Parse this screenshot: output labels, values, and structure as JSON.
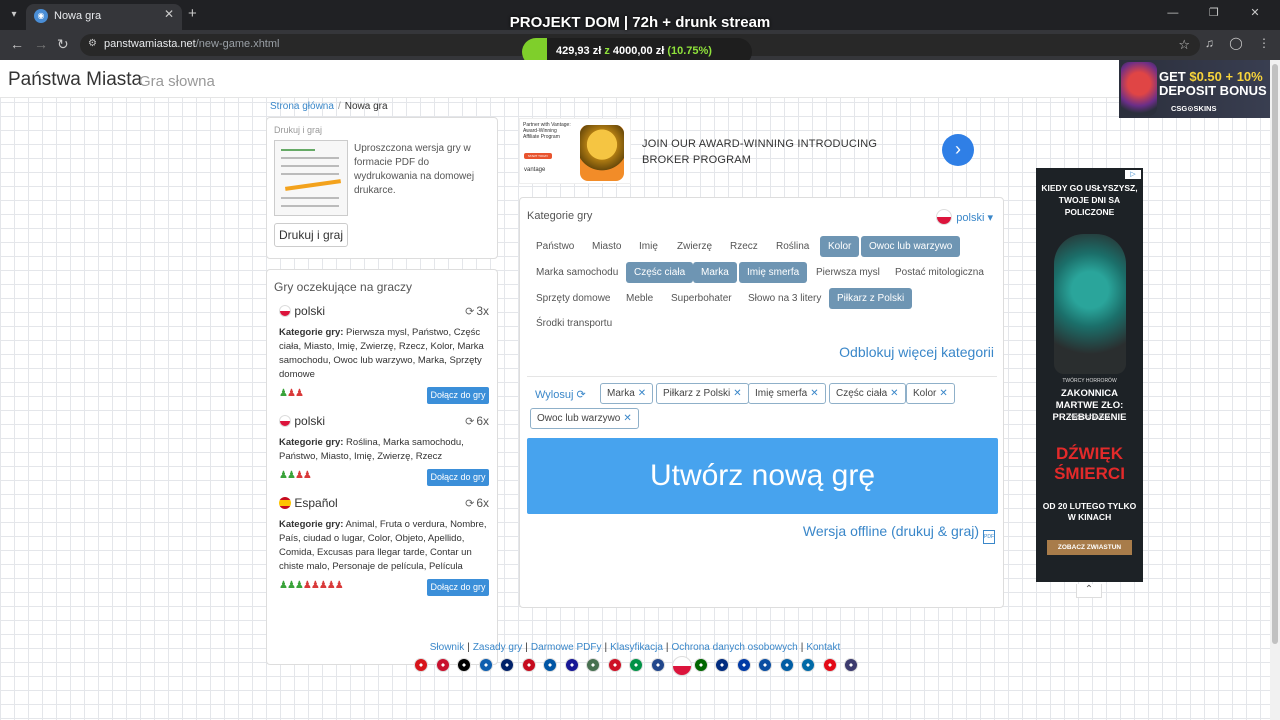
{
  "browser": {
    "tab_title": "Nowa gra",
    "url_host": "panstwamiasta.net",
    "url_path": "/new-game.xhtml"
  },
  "overlay": {
    "title": "PROJEKT DOM | 72h + drunk stream",
    "goal_current": "429,93 zł",
    "goal_sep": "z",
    "goal_target": "4000,00 zł",
    "goal_percent": "(10.75%)",
    "goal_fraction": 0.1075
  },
  "header": {
    "title": "Państwa Miasta",
    "subtitle": "Gra słowna"
  },
  "breadcrumb": {
    "home": "Strona główna",
    "sep": "/",
    "current": "Nowa gra"
  },
  "print_card": {
    "heading": "Drukuj i graj",
    "description": "Uproszczona wersja gry w formacie PDF do wydrukowania na domowej drukarce.",
    "button": "Drukuj i graj"
  },
  "games": {
    "title": "Gry oczekujące na graczy",
    "join_label": "Dołącz do gry",
    "cats_label": "Kategorie gry:",
    "items": [
      {
        "lang": "polski",
        "count": "3x",
        "categories": "Pierwsza mysl, Państwo, Częśc ciała, Miasto, Imię, Zwierzę, Rzecz, Kolor, Marka samochodu, Owoc lub warzywo, Marka, Sprzęty domowe",
        "players_green": 1,
        "players_red": 2
      },
      {
        "lang": "polski",
        "count": "6x",
        "categories": "Roślina, Marka samochodu, Państwo, Miasto, Imię, Zwierzę, Rzecz",
        "players_green": 2,
        "players_red": 2
      },
      {
        "lang": "Español",
        "count": "6x",
        "categories": "Animal, Fruta o verdura, Nombre, País, ciudad o lugar, Color, Objeto, Apellido, Comida, Excusas para llegar tarde, Contar un chiste malo, Personaje de película, Película",
        "players_green": 3,
        "players_red": 5
      }
    ]
  },
  "ad_top": {
    "img_text": "Partner with Vantage: Award-Winning Affiliate Program",
    "img_button": "START TODAY",
    "img_brand": "vantage",
    "text": "JOIN OUR AWARD-WINNING INTRODUCING BROKER PROGRAM",
    "next_icon": "chevron-right"
  },
  "categories": {
    "title": "Kategorie gry",
    "language": "polski",
    "chips": [
      {
        "label": "Państwo",
        "selected": false
      },
      {
        "label": "Miasto",
        "selected": false
      },
      {
        "label": "Imię",
        "selected": false
      },
      {
        "label": "Zwierzę",
        "selected": false
      },
      {
        "label": "Rzecz",
        "selected": false
      },
      {
        "label": "Roślina",
        "selected": false
      },
      {
        "label": "Kolor",
        "selected": true
      },
      {
        "label": "Owoc lub warzywo",
        "selected": true
      },
      {
        "label": "Marka samochodu",
        "selected": false
      },
      {
        "label": "Częśc ciała",
        "selected": true
      },
      {
        "label": "Marka",
        "selected": true
      },
      {
        "label": "Imię smerfa",
        "selected": true
      },
      {
        "label": "Pierwsza mysl",
        "selected": false
      },
      {
        "label": "Postać mitologiczna",
        "selected": false
      },
      {
        "label": "Sprzęty domowe",
        "selected": false
      },
      {
        "label": "Meble",
        "selected": false
      },
      {
        "label": "Superbohater",
        "selected": false
      },
      {
        "label": "Słowo na 3 litery",
        "selected": false
      },
      {
        "label": "Piłkarz z Polski",
        "selected": true
      },
      {
        "label": "Środki transportu",
        "selected": false
      }
    ],
    "unlock": "Odblokuj więcej kategorii",
    "draw": "Wylosuj",
    "selected_tags": [
      "Marka",
      "Piłkarz z Polski",
      "Imię smerfa",
      "Częśc ciała",
      "Kolor",
      "Owoc lub warzywo"
    ],
    "create_button": "Utwórz nową grę",
    "offline": "Wersja offline (drukuj & graj)",
    "offline_icon": "PDF"
  },
  "ad_side": {
    "choices": "▷",
    "line1": "KIEDY GO USŁYSZYSZ, TWOJE DNI SA POLICZONE",
    "small": "TWÓRCY HORRORÓW",
    "line2": "ZAKONNICA MARTWE ZŁO: PRZEBUDZENIE",
    "presents": "PRZEDSTAWIAJĄ",
    "title": "DŹWIĘK ŚMIERCI",
    "date": "OD 20 LUTEGO TYLKO W KINACH",
    "button": "ZOBACZ ZWIASTUN"
  },
  "ad_csg": {
    "line1a": "GET ",
    "line1b": "$0.50 + 10%",
    "line2": "DEPOSIT BONUS",
    "brand": "CSG⊙SKINS"
  },
  "footer": {
    "links": [
      "Słownik",
      "Zasady gry",
      "Darmowe PDFy",
      "Klasyfikacja",
      "Ochrona danych osobowych",
      "Kontakt"
    ],
    "flags": [
      "cz",
      "dk",
      "de",
      "gr",
      "gb",
      "es",
      "fr",
      "hr",
      "hu",
      "id",
      "it",
      "nl",
      "pl",
      "pt",
      "ro",
      "ru",
      "sk",
      "si",
      "se",
      "tr",
      "us"
    ],
    "flag_colors": {
      "cz": "#d7141a",
      "dk": "#c8102e",
      "de": "#000000",
      "gr": "#0d5eaf",
      "gb": "#012169",
      "es": "#c60b1e",
      "fr": "#0055a4",
      "hr": "#171796",
      "hu": "#477050",
      "id": "#ce1126",
      "it": "#009246",
      "nl": "#21468b",
      "pl": "#dc143c",
      "pt": "#006600",
      "ro": "#002b7f",
      "ru": "#0039a6",
      "sk": "#0b4ea2",
      "si": "#005da4",
      "se": "#006aa7",
      "tr": "#e30a17",
      "us": "#3c3b6e"
    }
  },
  "colors": {
    "accent": "#3a87c9",
    "chip_selected": "#6e95b3",
    "create_button": "#47a3ee",
    "join_button": "#3b8fd9"
  }
}
